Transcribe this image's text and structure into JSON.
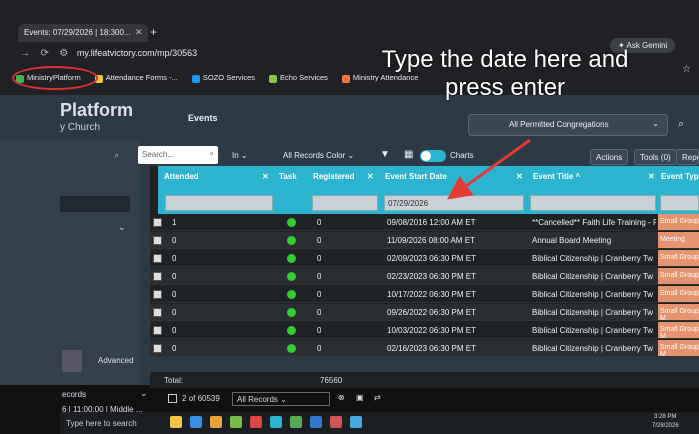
{
  "browser": {
    "tab_title": "Events: 07/29/2026 | 18:300...",
    "url": "my.lifeatvictory.com/mp/30563",
    "gemini_label": "Ask Gemini",
    "bookmarks": [
      {
        "label": "MinistryPlatform",
        "color": "#4caf50"
      },
      {
        "label": "Attendance Forms -...",
        "color": "#f4c542"
      },
      {
        "label": "SOZO Services",
        "color": "#2196f3"
      },
      {
        "label": "Echo Services",
        "color": "#8bc34a"
      },
      {
        "label": "Ministry Attendance",
        "color": "#ff7043"
      }
    ]
  },
  "annotation": {
    "line1": "Type the date here and",
    "line2": "press enter"
  },
  "app": {
    "brand": "Platform",
    "brand_sub": "y Church",
    "page_title": "Events",
    "congregations": "All Permitted Congregations",
    "sidebar_advanced": "Advanced",
    "sidebar_records": "ecords",
    "sidebar_footer": "6 | 11:00:00 | Middle ..."
  },
  "toolbar": {
    "search_placeholder": "Search...",
    "in_label": "In",
    "records_color": "All Records Color",
    "charts_label": "Charts",
    "actions": "Actions",
    "tools": "Tools (0)",
    "reports": "Repo"
  },
  "columns": [
    {
      "label": "Attended"
    },
    {
      "label": "Task"
    },
    {
      "label": "Registered"
    },
    {
      "label": "Event Start Date"
    },
    {
      "label": "Event Title ^"
    },
    {
      "label": "Event Type"
    }
  ],
  "filter_date_value": "07/29/2026",
  "rows": [
    {
      "attended": "1",
      "registered": "0",
      "date": "09/08/2016 12:00 AM ET",
      "title": "**Cancelled** Faith Life Training - F",
      "type": "Small Group"
    },
    {
      "attended": "0",
      "registered": "0",
      "date": "11/09/2026 08:00 AM ET",
      "title": "Annual Board Meeting",
      "type": "Meeting"
    },
    {
      "attended": "0",
      "registered": "0",
      "date": "02/09/2023 06:30 PM ET",
      "title": "Biblical Citizenship | Cranberry Tw",
      "type": "Small Group"
    },
    {
      "attended": "0",
      "registered": "0",
      "date": "02/23/2023 06:30 PM ET",
      "title": "Biblical Citizenship | Cranberry Tw",
      "type": "Small Group"
    },
    {
      "attended": "0",
      "registered": "0",
      "date": "10/17/2022 06:30 PM ET",
      "title": "Biblical Citizenship | Cranberry Tw",
      "type": "Small Group"
    },
    {
      "attended": "0",
      "registered": "0",
      "date": "09/26/2022 06:30 PM ET",
      "title": "Biblical Citizenship | Cranberry Tw",
      "type": "Small Group M"
    },
    {
      "attended": "0",
      "registered": "0",
      "date": "10/03/2022 06:30 PM ET",
      "title": "Biblical Citizenship | Cranberry Tw",
      "type": "Small Group M"
    },
    {
      "attended": "0",
      "registered": "0",
      "date": "02/16/2023 06:30 PM ET",
      "title": "Biblical Citizenship | Cranberry Tw",
      "type": "Small Group M"
    }
  ],
  "footer": {
    "total_label": "Total:",
    "total_value": "76560",
    "pager": "2 of 60539",
    "records_select": "All Records"
  },
  "taskbar": {
    "search": "Type here to search",
    "time": "3:28 PM",
    "date": "7/28/2026"
  },
  "colors": {
    "header": "#2bb3d0",
    "tag": "#e4946f",
    "arrow": "#e53935"
  }
}
